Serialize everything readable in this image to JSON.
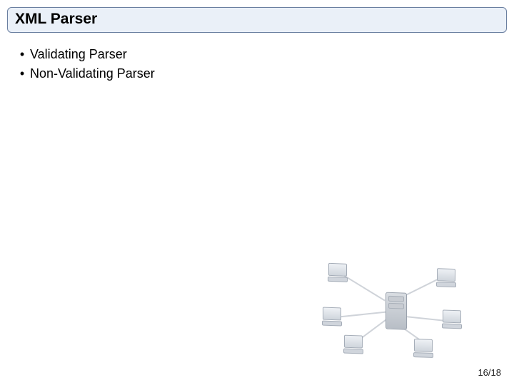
{
  "title": "XML Parser",
  "bullets": [
    "Validating Parser",
    "Non-Validating Parser"
  ],
  "page": {
    "current": 16,
    "total": 18,
    "display": "16/18"
  }
}
